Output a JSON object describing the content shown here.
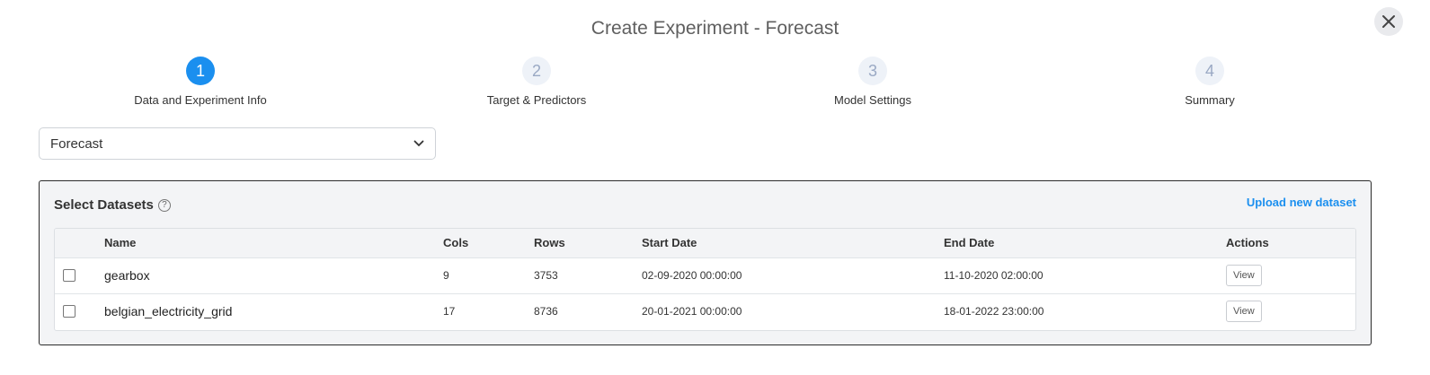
{
  "modal": {
    "title": "Create Experiment - Forecast"
  },
  "steps": [
    {
      "number": "1",
      "label": "Data and Experiment Info",
      "active": true
    },
    {
      "number": "2",
      "label": "Target & Predictors",
      "active": false
    },
    {
      "number": "3",
      "label": "Model Settings",
      "active": false
    },
    {
      "number": "4",
      "label": "Summary",
      "active": false
    }
  ],
  "experiment_type": {
    "selected": "Forecast"
  },
  "datasets": {
    "title": "Select Datasets",
    "help_icon": "?",
    "upload_label": "Upload new dataset",
    "columns": [
      "",
      "Name",
      "Cols",
      "Rows",
      "Start Date",
      "End Date",
      "Actions"
    ],
    "rows": [
      {
        "name": "gearbox",
        "cols": "9",
        "rows": "3753",
        "start": "02-09-2020 00:00:00",
        "end": "11-10-2020 02:00:00",
        "action": "View"
      },
      {
        "name": "belgian_electricity_grid",
        "cols": "17",
        "rows": "8736",
        "start": "20-01-2021 00:00:00",
        "end": "18-01-2022 23:00:00",
        "action": "View"
      }
    ]
  },
  "colors": {
    "accent": "#1b8fef",
    "step_inactive_bg": "#eef2f8",
    "panel_bg": "#f3f4f6"
  },
  "icons": {
    "close": "close-icon",
    "dropdown": "chevron-down-icon",
    "help": "help-circle-icon"
  }
}
